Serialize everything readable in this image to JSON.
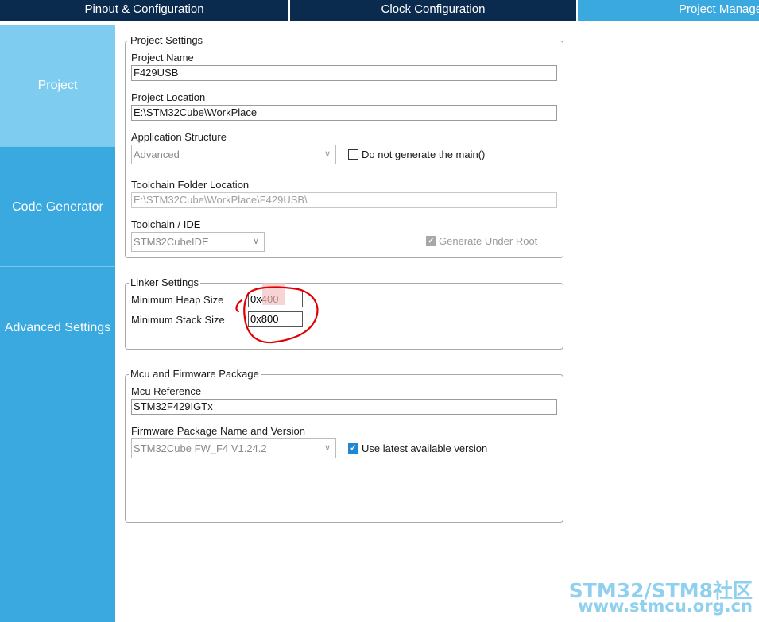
{
  "tabs": [
    "Pinout & Configuration",
    "Clock Configuration",
    "Project Manager"
  ],
  "sidebar": {
    "items": [
      {
        "label": "Project",
        "active": true
      },
      {
        "label": "Code Generator",
        "active": false
      },
      {
        "label": "Advanced Settings",
        "active": false
      }
    ]
  },
  "project_settings": {
    "legend": "Project Settings",
    "name_label": "Project Name",
    "name_value": "F429USB",
    "location_label": "Project Location",
    "location_value": "E:\\STM32Cube\\WorkPlace",
    "structure_label": "Application Structure",
    "structure_value": "Advanced",
    "no_main_label": "Do not generate the main()",
    "no_main_checked": false,
    "toolchain_folder_label": "Toolchain Folder Location",
    "toolchain_folder_value": "E:\\STM32Cube\\WorkPlace\\F429USB\\",
    "toolchain_label": "Toolchain / IDE",
    "toolchain_value": "STM32CubeIDE",
    "under_root_label": "Generate Under Root",
    "under_root_checked": true
  },
  "linker_settings": {
    "legend": "Linker Settings",
    "heap_label": "Minimum Heap Size",
    "heap_value": "0x400",
    "stack_label": "Minimum Stack Size",
    "stack_value": "0x800"
  },
  "mcu_firmware": {
    "legend": "Mcu and Firmware Package",
    "mcu_label": "Mcu Reference",
    "mcu_value": "STM32F429IGTx",
    "fw_label": "Firmware Package Name and Version",
    "fw_value": "STM32Cube FW_F4 V1.24.2",
    "use_latest_label": "Use latest available version",
    "use_latest_checked": true
  },
  "watermark": {
    "line1": "STM32/STM8社区",
    "line2": "www.stmcu.org.cn"
  },
  "colors": {
    "tabbar": "#0a2a4e",
    "accent": "#3aa9df",
    "sidebar_active": "#7ecdf0",
    "annotation": "#e00000"
  }
}
